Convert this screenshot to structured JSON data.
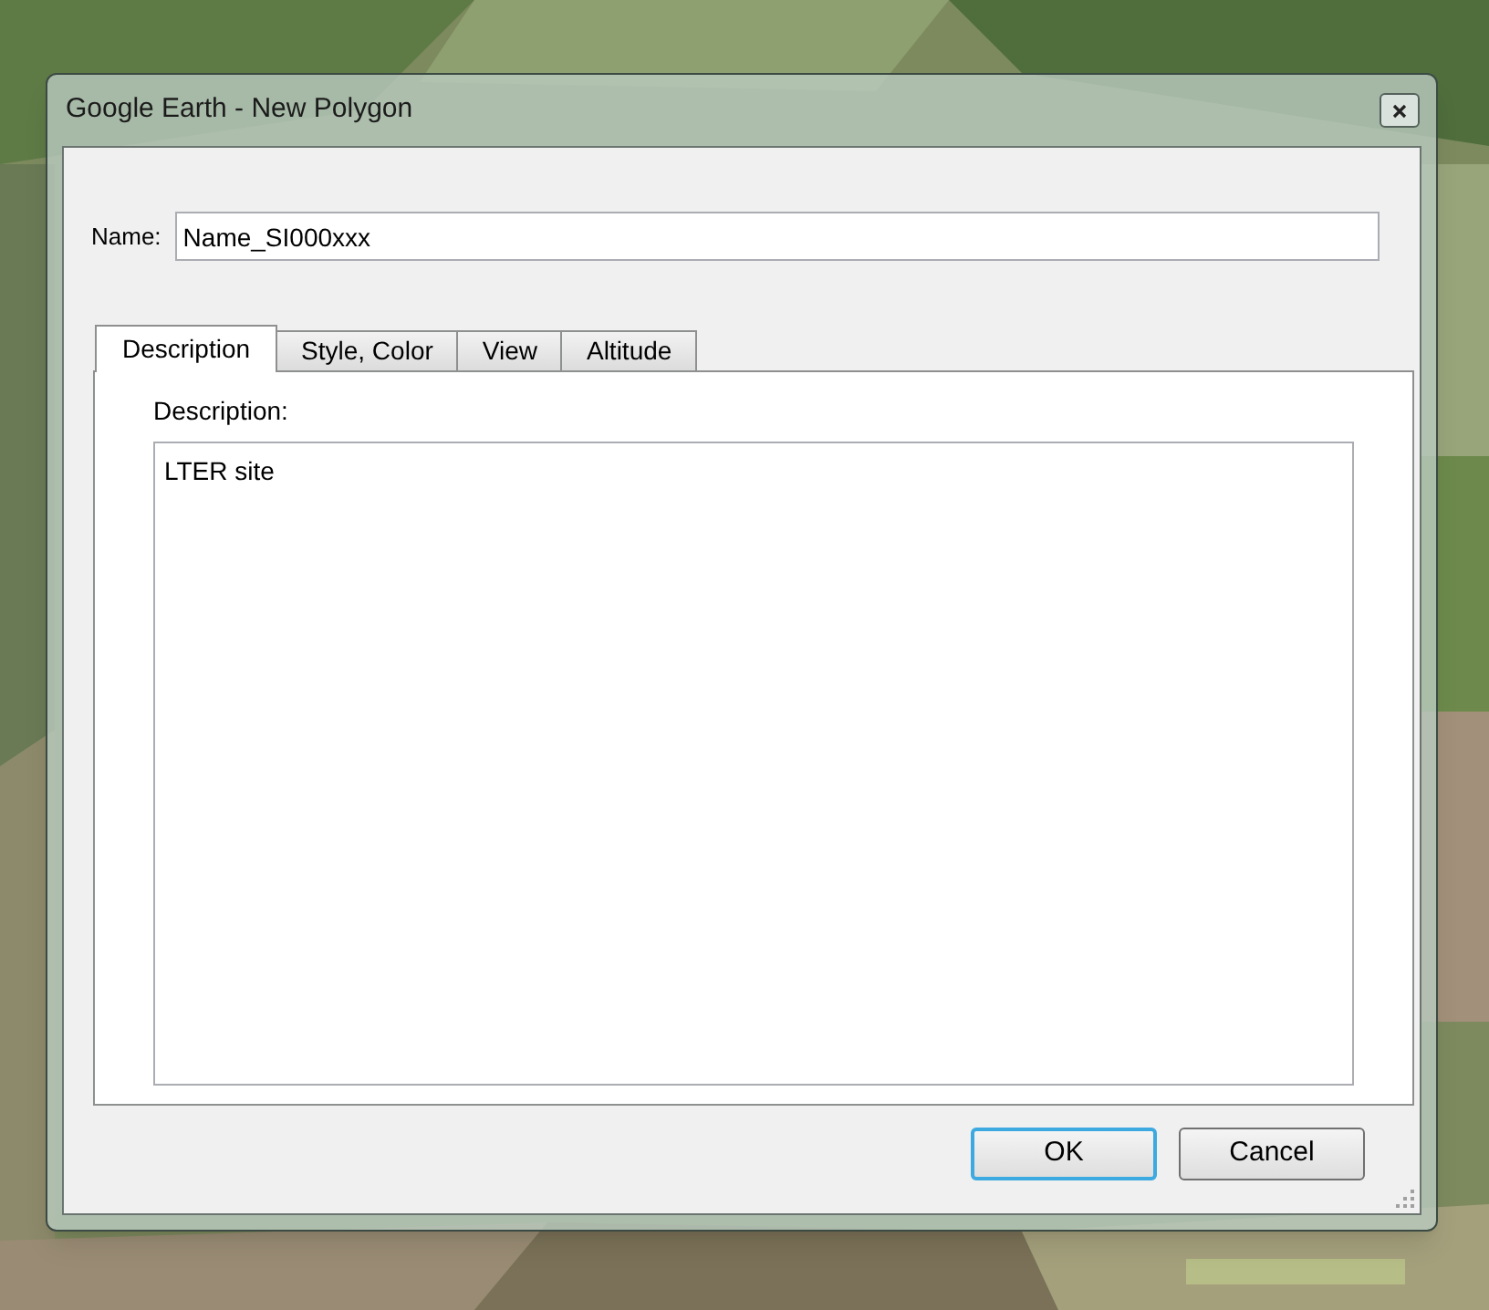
{
  "window": {
    "title": "Google Earth - New Polygon"
  },
  "name_field": {
    "label": "Name:",
    "value": "Name_SI000xxx"
  },
  "tabs": [
    {
      "label": "Description",
      "selected": true
    },
    {
      "label": "Style, Color",
      "selected": false
    },
    {
      "label": "View",
      "selected": false
    },
    {
      "label": "Altitude",
      "selected": false
    }
  ],
  "description": {
    "label": "Description:",
    "value": "LTER site"
  },
  "buttons": [
    {
      "label": "OK",
      "default": true
    },
    {
      "label": "Cancel",
      "default": false
    }
  ]
}
